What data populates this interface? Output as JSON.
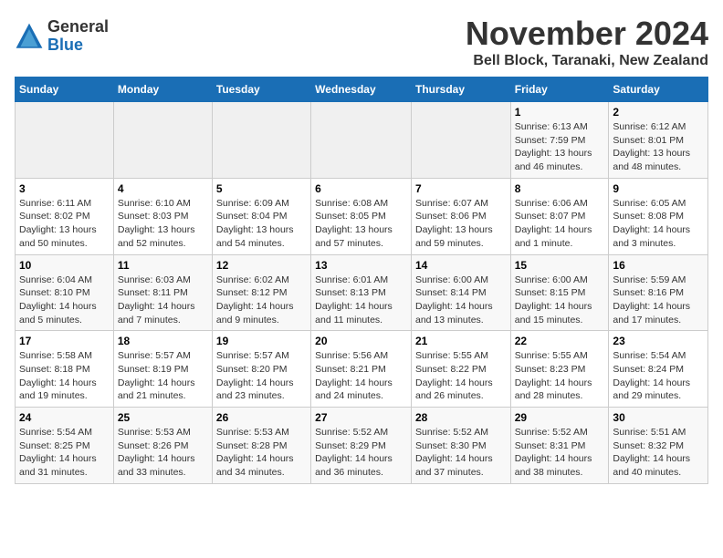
{
  "logo": {
    "general": "General",
    "blue": "Blue"
  },
  "header": {
    "month": "November 2024",
    "location": "Bell Block, Taranaki, New Zealand"
  },
  "weekdays": [
    "Sunday",
    "Monday",
    "Tuesday",
    "Wednesday",
    "Thursday",
    "Friday",
    "Saturday"
  ],
  "weeks": [
    [
      {
        "day": "",
        "info": ""
      },
      {
        "day": "",
        "info": ""
      },
      {
        "day": "",
        "info": ""
      },
      {
        "day": "",
        "info": ""
      },
      {
        "day": "",
        "info": ""
      },
      {
        "day": "1",
        "info": "Sunrise: 6:13 AM\nSunset: 7:59 PM\nDaylight: 13 hours\nand 46 minutes."
      },
      {
        "day": "2",
        "info": "Sunrise: 6:12 AM\nSunset: 8:01 PM\nDaylight: 13 hours\nand 48 minutes."
      }
    ],
    [
      {
        "day": "3",
        "info": "Sunrise: 6:11 AM\nSunset: 8:02 PM\nDaylight: 13 hours\nand 50 minutes."
      },
      {
        "day": "4",
        "info": "Sunrise: 6:10 AM\nSunset: 8:03 PM\nDaylight: 13 hours\nand 52 minutes."
      },
      {
        "day": "5",
        "info": "Sunrise: 6:09 AM\nSunset: 8:04 PM\nDaylight: 13 hours\nand 54 minutes."
      },
      {
        "day": "6",
        "info": "Sunrise: 6:08 AM\nSunset: 8:05 PM\nDaylight: 13 hours\nand 57 minutes."
      },
      {
        "day": "7",
        "info": "Sunrise: 6:07 AM\nSunset: 8:06 PM\nDaylight: 13 hours\nand 59 minutes."
      },
      {
        "day": "8",
        "info": "Sunrise: 6:06 AM\nSunset: 8:07 PM\nDaylight: 14 hours\nand 1 minute."
      },
      {
        "day": "9",
        "info": "Sunrise: 6:05 AM\nSunset: 8:08 PM\nDaylight: 14 hours\nand 3 minutes."
      }
    ],
    [
      {
        "day": "10",
        "info": "Sunrise: 6:04 AM\nSunset: 8:10 PM\nDaylight: 14 hours\nand 5 minutes."
      },
      {
        "day": "11",
        "info": "Sunrise: 6:03 AM\nSunset: 8:11 PM\nDaylight: 14 hours\nand 7 minutes."
      },
      {
        "day": "12",
        "info": "Sunrise: 6:02 AM\nSunset: 8:12 PM\nDaylight: 14 hours\nand 9 minutes."
      },
      {
        "day": "13",
        "info": "Sunrise: 6:01 AM\nSunset: 8:13 PM\nDaylight: 14 hours\nand 11 minutes."
      },
      {
        "day": "14",
        "info": "Sunrise: 6:00 AM\nSunset: 8:14 PM\nDaylight: 14 hours\nand 13 minutes."
      },
      {
        "day": "15",
        "info": "Sunrise: 6:00 AM\nSunset: 8:15 PM\nDaylight: 14 hours\nand 15 minutes."
      },
      {
        "day": "16",
        "info": "Sunrise: 5:59 AM\nSunset: 8:16 PM\nDaylight: 14 hours\nand 17 minutes."
      }
    ],
    [
      {
        "day": "17",
        "info": "Sunrise: 5:58 AM\nSunset: 8:18 PM\nDaylight: 14 hours\nand 19 minutes."
      },
      {
        "day": "18",
        "info": "Sunrise: 5:57 AM\nSunset: 8:19 PM\nDaylight: 14 hours\nand 21 minutes."
      },
      {
        "day": "19",
        "info": "Sunrise: 5:57 AM\nSunset: 8:20 PM\nDaylight: 14 hours\nand 23 minutes."
      },
      {
        "day": "20",
        "info": "Sunrise: 5:56 AM\nSunset: 8:21 PM\nDaylight: 14 hours\nand 24 minutes."
      },
      {
        "day": "21",
        "info": "Sunrise: 5:55 AM\nSunset: 8:22 PM\nDaylight: 14 hours\nand 26 minutes."
      },
      {
        "day": "22",
        "info": "Sunrise: 5:55 AM\nSunset: 8:23 PM\nDaylight: 14 hours\nand 28 minutes."
      },
      {
        "day": "23",
        "info": "Sunrise: 5:54 AM\nSunset: 8:24 PM\nDaylight: 14 hours\nand 29 minutes."
      }
    ],
    [
      {
        "day": "24",
        "info": "Sunrise: 5:54 AM\nSunset: 8:25 PM\nDaylight: 14 hours\nand 31 minutes."
      },
      {
        "day": "25",
        "info": "Sunrise: 5:53 AM\nSunset: 8:26 PM\nDaylight: 14 hours\nand 33 minutes."
      },
      {
        "day": "26",
        "info": "Sunrise: 5:53 AM\nSunset: 8:28 PM\nDaylight: 14 hours\nand 34 minutes."
      },
      {
        "day": "27",
        "info": "Sunrise: 5:52 AM\nSunset: 8:29 PM\nDaylight: 14 hours\nand 36 minutes."
      },
      {
        "day": "28",
        "info": "Sunrise: 5:52 AM\nSunset: 8:30 PM\nDaylight: 14 hours\nand 37 minutes."
      },
      {
        "day": "29",
        "info": "Sunrise: 5:52 AM\nSunset: 8:31 PM\nDaylight: 14 hours\nand 38 minutes."
      },
      {
        "day": "30",
        "info": "Sunrise: 5:51 AM\nSunset: 8:32 PM\nDaylight: 14 hours\nand 40 minutes."
      }
    ]
  ]
}
